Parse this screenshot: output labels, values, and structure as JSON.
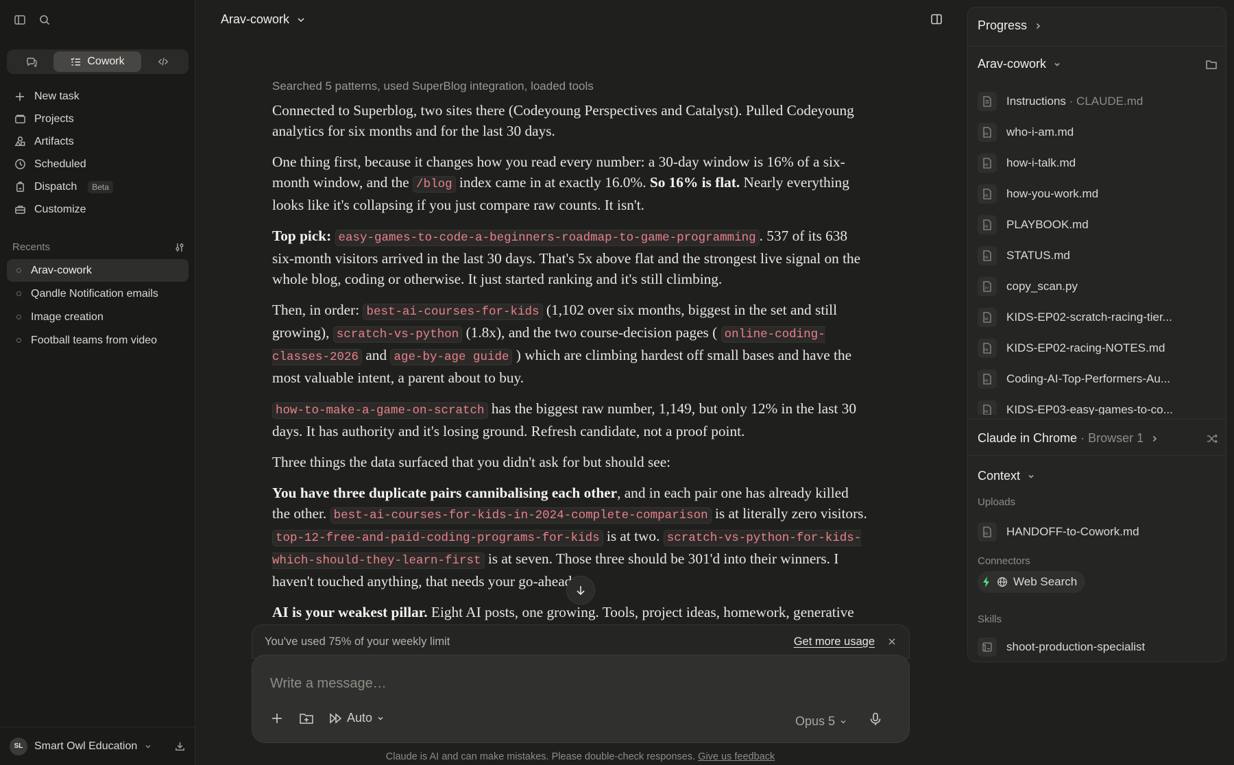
{
  "sidebar": {
    "mode_switch": {
      "active_label": "Cowork"
    },
    "nav": [
      {
        "label": "New task",
        "icon": "plus-icon"
      },
      {
        "label": "Projects",
        "icon": "folder-icon"
      },
      {
        "label": "Artifacts",
        "icon": "artifacts-icon"
      },
      {
        "label": "Scheduled",
        "icon": "clock-icon"
      },
      {
        "label": "Dispatch",
        "icon": "dispatch-icon",
        "badge": "Beta"
      },
      {
        "label": "Customize",
        "icon": "toolbox-icon"
      }
    ],
    "recents_label": "Recents",
    "recents": [
      {
        "label": "Arav-cowork",
        "active": true
      },
      {
        "label": "Qandle Notification emails"
      },
      {
        "label": "Image creation"
      },
      {
        "label": "Football teams from video"
      }
    ],
    "footer": {
      "initials": "SL",
      "org": "Smart Owl Education"
    }
  },
  "header": {
    "title": "Arav-cowork"
  },
  "conversation": {
    "tool_summary": "Searched 5 patterns, used SuperBlog integration, loaded tools",
    "p1": "Connected to Superblog, two sites there (Codeyoung Perspectives and Catalyst). Pulled Codeyoung analytics for six months and for the last 30 days.",
    "p2": {
      "a": "One thing first, because it changes how you read every number: a 30-day window is 16% of a six-month window, and the ",
      "code": "/blog",
      "b": " index came in at exactly 16.0%. ",
      "bold": "So 16% is flat.",
      "c": " Nearly everything looks like it's collapsing if you just compare raw counts. It isn't."
    },
    "p3": {
      "bold": "Top pick:",
      "code": "easy-games-to-code-a-beginners-roadmap-to-game-programming",
      "text": ". 537 of its 638 six-month visitors arrived in the last 30 days. That's 5x above flat and the strongest live signal on the whole blog, coding or otherwise. It just started ranking and it's still climbing."
    },
    "p4": {
      "a": "Then, in order: ",
      "code1": "best-ai-courses-for-kids",
      "b": " (1,102 over six months, biggest in the set and still growing), ",
      "code2": "scratch-vs-python",
      "c": " (1.8x), and the two course-decision pages ( ",
      "code3": "online-coding-classes-2026",
      "d": " and ",
      "code4": "age-by-age guide",
      "e": " ) which are climbing hardest off small bases and have the most valuable intent, a parent about to buy."
    },
    "p5": {
      "code": "how-to-make-a-game-on-scratch",
      "text": " has the biggest raw number, 1,149, but only 12% in the last 30 days. It has authority and it's losing ground. Refresh candidate, not a proof point."
    },
    "p6": "Three things the data surfaced that you didn't ask for but should see:",
    "p7": {
      "bold": "You have three duplicate pairs cannibalising each other",
      "a": ", and in each pair one has already killed the other. ",
      "code1": "best-ai-courses-for-kids-in-2024-complete-comparison",
      "b": " is at literally zero visitors. ",
      "code2": "top-12-free-and-paid-coding-programs-for-kids",
      "c": " is at two. ",
      "code3": "scratch-vs-python-for-kids-which-should-they-learn-first",
      "d": " is at seven. Those three should be 301'd into their winners. I haven't touched anything, that needs your go-ahead."
    },
    "p8": {
      "bold": "AI is your weakest pillar.",
      "text": " Eight AI posts, one growing. Tools, project ideas, homework, generative AI, prompt writing, learning tools, all fading or dying. Worth knowing since AI is a"
    }
  },
  "usage": {
    "text": "You've used 75% of your weekly limit",
    "link": "Get more usage"
  },
  "composer": {
    "placeholder": "Write a message…",
    "mode": "Auto",
    "model": "Opus 5"
  },
  "disclaimer": {
    "text": "Claude is AI and can make mistakes. Please double-check responses. ",
    "link": "Give us feedback"
  },
  "right_panel": {
    "progress_label": "Progress",
    "folder_name": "Arav-cowork",
    "files": [
      {
        "name": "Instructions",
        "suffix": " · CLAUDE.md"
      },
      {
        "name": "who-i-am.md"
      },
      {
        "name": "how-i-talk.md"
      },
      {
        "name": "how-you-work.md"
      },
      {
        "name": "PLAYBOOK.md"
      },
      {
        "name": "STATUS.md"
      },
      {
        "name": "copy_scan.py"
      },
      {
        "name": "KIDS-EP02-scratch-racing-tier..."
      },
      {
        "name": "KIDS-EP02-racing-NOTES.md"
      },
      {
        "name": "Coding-AI-Top-Performers-Au..."
      },
      {
        "name": "KIDS-EP03-easy-games-to-co..."
      }
    ],
    "chrome": {
      "title": "Claude in Chrome",
      "sub": " · Browser 1"
    },
    "context_label": "Context",
    "uploads_label": "Uploads",
    "upload_file": "HANDOFF-to-Cowork.md",
    "connectors_label": "Connectors",
    "connector": "Web Search",
    "skills_label": "Skills",
    "skill": "shoot-production-specialist"
  },
  "colors": {
    "background": "#1f1f1e",
    "sidebar": "#1a1a19",
    "code_text": "#e8828a",
    "connector_bolt": "#4ade80"
  }
}
